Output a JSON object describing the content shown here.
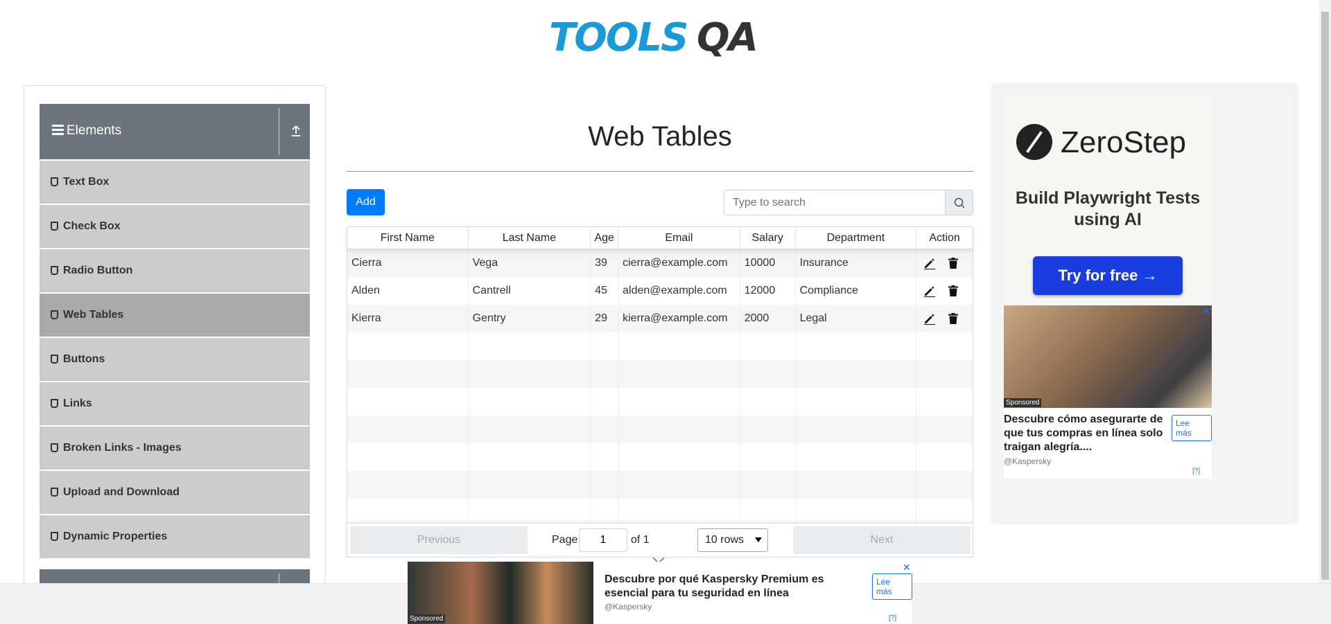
{
  "header": {
    "logo_tools": "TOOLS",
    "logo_qa": "QA",
    "logo_alt": "ToolsQA"
  },
  "sidebar": {
    "group_title": "Elements",
    "items": [
      {
        "label": "Text Box",
        "active": false
      },
      {
        "label": "Check Box",
        "active": false
      },
      {
        "label": "Radio Button",
        "active": false
      },
      {
        "label": "Web Tables",
        "active": true
      },
      {
        "label": "Buttons",
        "active": false
      },
      {
        "label": "Links",
        "active": false
      },
      {
        "label": "Broken Links - Images",
        "active": false
      },
      {
        "label": "Upload and Download",
        "active": false
      },
      {
        "label": "Dynamic Properties",
        "active": false
      }
    ]
  },
  "main": {
    "title": "Web Tables",
    "add_label": "Add",
    "search_placeholder": "Type to search",
    "columns": [
      "First Name",
      "Last Name",
      "Age",
      "Email",
      "Salary",
      "Department",
      "Action"
    ],
    "rows": [
      [
        "Cierra",
        "Vega",
        "39",
        "cierra@example.com",
        "10000",
        "Insurance"
      ],
      [
        "Alden",
        "Cantrell",
        "45",
        "alden@example.com",
        "12000",
        "Compliance"
      ],
      [
        "Kierra",
        "Gentry",
        "29",
        "kierra@example.com",
        "2000",
        "Legal"
      ]
    ],
    "empty_rows": 7,
    "pagination": {
      "previous": "Previous",
      "page_label": "Page",
      "page_value": "1",
      "of_label": "of 1",
      "rows_option": "10 rows",
      "next": "Next"
    }
  },
  "ads": {
    "zerostep": {
      "name": "ZeroStep",
      "tagline": "Build Playwright Tests using AI",
      "button": "Try for free →",
      "brand_color": "#1a3de0"
    },
    "kaspersky_right": {
      "sponsored": "Sponsored",
      "title": "Descubre cómo asegurarte de que tus compras en línea solo traigan alegría....",
      "source": "@Kaspersky",
      "cta": "Lee más",
      "close": "✕",
      "adchoices": "[?]"
    },
    "kaspersky_bottom": {
      "sponsored": "Sponsored",
      "title": "Descubre por qué Kaspersky Premium es esencial para tu seguridad en línea",
      "source": "@Kaspersky",
      "cta": "Lee más",
      "close": "✕",
      "adchoices": "[?]"
    }
  },
  "colors": {
    "accent": "#007bff",
    "sidebar_header": "#6c757d",
    "menu_item": "#cccccc",
    "menu_active": "#aaaaaa",
    "logo_blue": "#1b9bd6"
  }
}
